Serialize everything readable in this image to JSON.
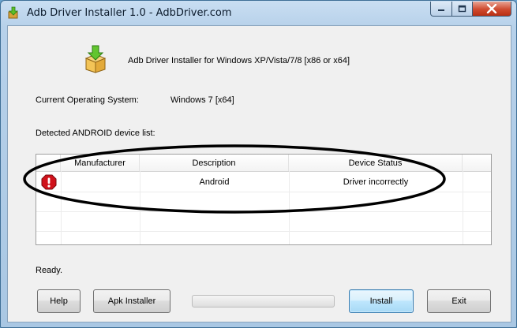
{
  "window": {
    "title": "Adb Driver Installer 1.0  -  AdbDriver.com"
  },
  "header": {
    "app_description": "Adb Driver Installer for Windows XP/Vista/7/8 [x86 or x64]",
    "logo_icon": "installer-box-download-icon"
  },
  "system": {
    "os_label": "Current Operating System:",
    "os_value": "Windows 7  [x64]"
  },
  "device_list": {
    "label": "Detected ANDROID device list:",
    "columns": [
      "Manufacturer",
      "Description",
      "Device Status"
    ],
    "rows": [
      {
        "status_icon": "error-icon",
        "manufacturer": "",
        "description": "Android",
        "status": "Driver incorrectly"
      }
    ]
  },
  "status": {
    "text": "Ready."
  },
  "buttons": {
    "help": "Help",
    "apk_installer": "Apk Installer",
    "install": "Install",
    "exit": "Exit"
  },
  "progress": {
    "value_percent": 0
  },
  "colors": {
    "error_red": "#d0121b",
    "annotation": "#000000"
  }
}
